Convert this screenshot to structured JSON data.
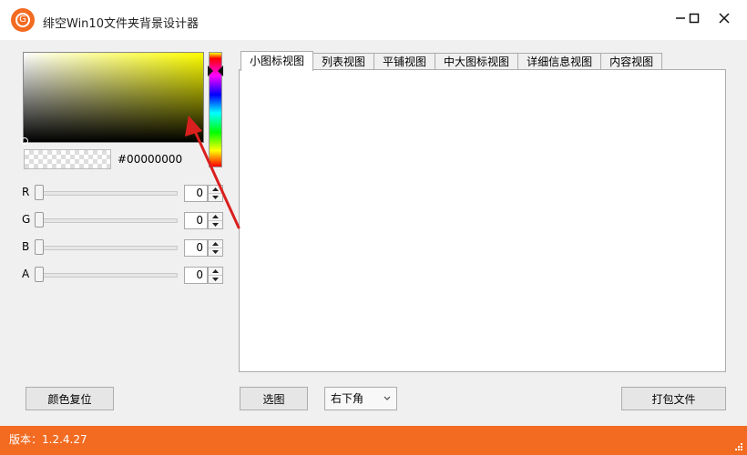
{
  "window": {
    "title": "绯空Win10文件夹背景设计器",
    "logo_letter": "G",
    "controls": [
      "minimize-icon",
      "maximize-icon",
      "close-icon"
    ]
  },
  "color_picker": {
    "hue_color": "#ffff00",
    "hex_value": "#00000000",
    "channels": [
      {
        "label": "R",
        "value": "0"
      },
      {
        "label": "G",
        "value": "0"
      },
      {
        "label": "B",
        "value": "0"
      },
      {
        "label": "A",
        "value": "0"
      }
    ],
    "reset_label": "颜色复位"
  },
  "tabs": {
    "items": [
      "小图标视图",
      "列表视图",
      "平铺视图",
      "中大图标视图",
      "详细信息视图",
      "内容视图"
    ],
    "active_index": 0
  },
  "bottom": {
    "select_image_label": "选图",
    "position_value": "右下角",
    "pack_label": "打包文件"
  },
  "status": {
    "version": "版本：1.2.4.27"
  },
  "colors": {
    "accent": "#f26b21",
    "annotation": "#d9201f"
  }
}
